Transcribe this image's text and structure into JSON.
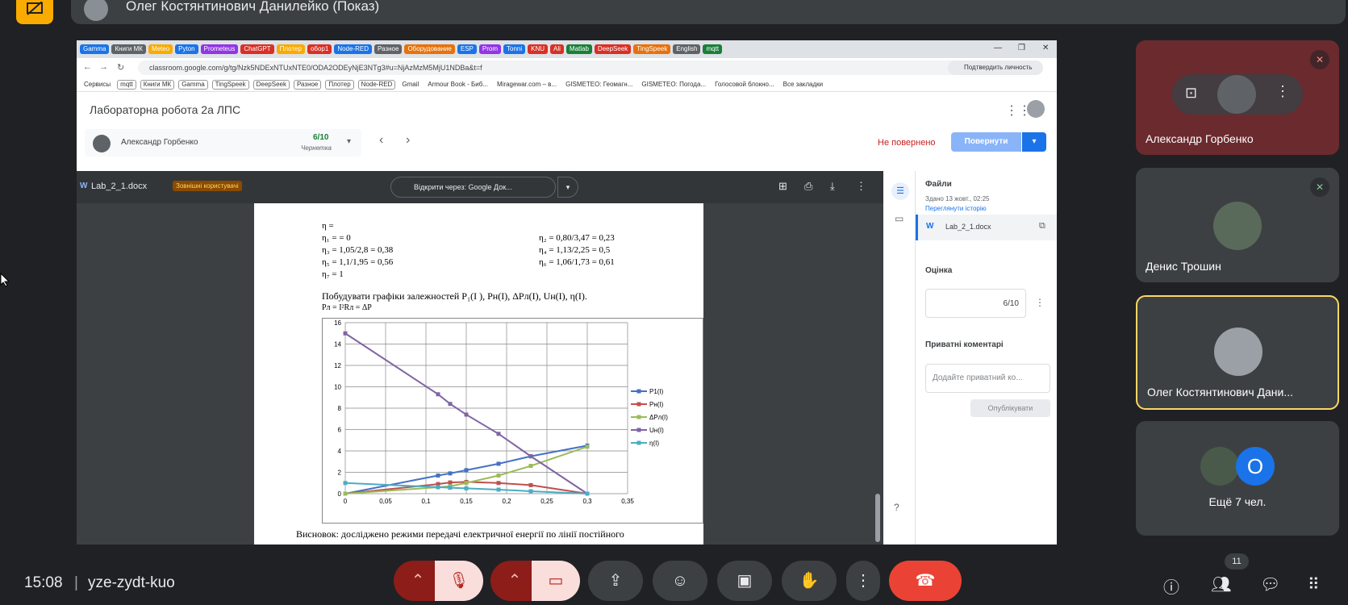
{
  "presenter": {
    "name": "Олег Костянтинович Данилейко (Показ)"
  },
  "browser": {
    "tabs": [
      "Gamma",
      "Книги МК",
      "Meteo",
      "Pyton",
      "Prometeus",
      "ChatGPT",
      "Плотер",
      "обор1",
      "Node-RED",
      "Разное",
      "Оборудование",
      "ESP",
      "Prom",
      "Tonni",
      "KNU",
      "Ali",
      "Matlab",
      "DeepSeek",
      "TingSpeek",
      "English",
      "mqtt"
    ],
    "tab_colors": [
      "#1a73e8",
      "#5f6368",
      "#f9ab00",
      "#1a73e8",
      "#9334e6",
      "#d93025",
      "#f9ab00",
      "#d93025",
      "#1a73e8",
      "#5f6368",
      "#e8710a",
      "#1a73e8",
      "#9334e6",
      "#1a73e8",
      "#d93025",
      "#d93025",
      "#188038",
      "#d93025",
      "#e8710a",
      "#5f6368",
      "#188038"
    ],
    "url": "classroom.google.com/g/tg/Nzk5NDExNTUxNTE0/ODA2ODEyNjE3NTg3#u=NjAzMzM5MjU1NDBa&t=f",
    "verify": "Подтвердить личность",
    "bookmarks": [
      "Сервисы",
      "mqtt",
      "Книги МК",
      "Gamma",
      "TingSpeek",
      "DeepSeek",
      "Разное",
      "Плотер",
      "Node-RED",
      "Gmail",
      "Armour Book - Биб...",
      "Miragewar.com – в...",
      "GISMETEO: Геомагн...",
      "GISMETEO: Погода...",
      "Голосовой блокно...",
      "Все закладки"
    ]
  },
  "classroom": {
    "title": "Лабораторна робота 2а ЛПС",
    "student_name": "Александр Горбенко",
    "student_grade": "6/10",
    "student_status": "Чернетка",
    "not_returned": "Не повернено",
    "return_button": "Повернути"
  },
  "viewer": {
    "file_name": "Lab_2_1.docx",
    "external_badge": "Зовнішні користувачі",
    "open_with": "Відкрити через: Google Док...",
    "doc_lines": {
      "l0": "η =",
      "l1": "η₁ = = 0",
      "l2": "η₃ = 1,05/2,8 = 0,38",
      "l3": "η₅ = 1,1/1,95 = 0,56",
      "l4": "η₇ = 1",
      "r1": "η₂ = 0,80/3,47 = 0,23",
      "r2": "η₄ = 1,13/2,25 = 0,5",
      "r3": "η₆ = 1,06/1,73 = 0,61",
      "task": "Побудувати графіки залежностей P₁(I ), Pн(I), ΔPл(I), Uн(I), η(I).",
      "formula": "Pл = I²Rл = ΔP",
      "conclusion": "Висновок: досліджено режими передачі електричної енергії по лінії постійного"
    }
  },
  "chart_data": {
    "type": "line",
    "xlim": [
      0,
      0.35
    ],
    "ylim": [
      0,
      16
    ],
    "x_ticks": [
      "0",
      "0,05",
      "0,1",
      "0,15",
      "0,2",
      "0,25",
      "0,3",
      "0,35"
    ],
    "y_ticks": [
      "0",
      "2",
      "4",
      "6",
      "8",
      "10",
      "12",
      "14",
      "16"
    ],
    "series": [
      {
        "name": "P1(I)",
        "color": "#4472c4",
        "marker": "diamond",
        "x": [
          0,
          0.115,
          0.13,
          0.15,
          0.19,
          0.23,
          0.3
        ],
        "y": [
          0,
          1.7,
          1.9,
          2.2,
          2.8,
          3.5,
          4.5
        ]
      },
      {
        "name": "Pн(I)",
        "color": "#c0504d",
        "marker": "square",
        "x": [
          0,
          0.115,
          0.13,
          0.15,
          0.19,
          0.23,
          0.3
        ],
        "y": [
          0,
          0.9,
          1.05,
          1.1,
          1.0,
          0.8,
          0
        ]
      },
      {
        "name": "ΔPл(I)",
        "color": "#9bbb59",
        "marker": "triangle",
        "x": [
          0,
          0.115,
          0.13,
          0.15,
          0.19,
          0.23,
          0.3
        ],
        "y": [
          0,
          0.6,
          0.7,
          1.0,
          1.7,
          2.6,
          4.4
        ]
      },
      {
        "name": "Uн(I)",
        "color": "#8064a2",
        "marker": "x",
        "x": [
          0,
          0.115,
          0.13,
          0.15,
          0.19,
          0.23,
          0.3
        ],
        "y": [
          15,
          9.3,
          8.4,
          7.4,
          5.6,
          3.5,
          0
        ]
      },
      {
        "name": "η(I)",
        "color": "#4bacc6",
        "marker": "star",
        "x": [
          0,
          0.115,
          0.13,
          0.15,
          0.19,
          0.23,
          0.3
        ],
        "y": [
          1,
          0.61,
          0.56,
          0.5,
          0.38,
          0.23,
          0
        ]
      }
    ]
  },
  "side_panel": {
    "files_heading": "Файли",
    "submitted": "Здано 13 жовт., 02:25",
    "history_link": "Переглянути історію",
    "file_name": "Lab_2_1.docx",
    "grade_heading": "Оцінка",
    "grade_value": "6/10",
    "comments_heading": "Приватні коментарі",
    "comment_placeholder": "Додайте приватний ко...",
    "publish": "Опублікувати"
  },
  "participants": [
    {
      "name": "Александр Горбенко",
      "muted": true
    },
    {
      "name": "Денис Трошин",
      "muted": true
    },
    {
      "name": "Олег Костянтинович Дани...",
      "muted": false
    },
    {
      "name": "Ещё 7 чел.",
      "muted": false
    }
  ],
  "more_avatar_letter": "О",
  "bottom": {
    "time": "15:08",
    "meeting_code": "yze-zydt-kuo",
    "people_count": "11"
  }
}
